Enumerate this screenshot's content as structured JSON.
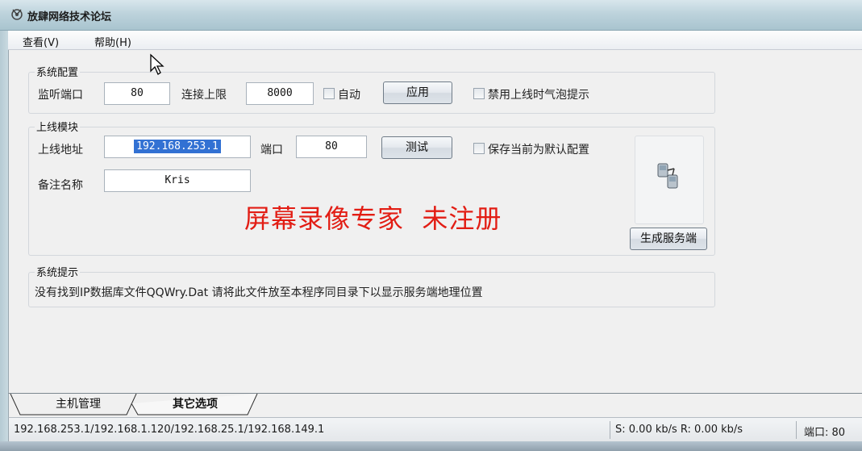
{
  "window": {
    "title": "放肆网络技术论坛",
    "icon": "app-icon"
  },
  "menu": {
    "items": [
      {
        "label": "查看(V)"
      },
      {
        "label": "帮助(H)"
      }
    ]
  },
  "system_config": {
    "title": "系统配置",
    "listen_port_label": "监听端口",
    "listen_port_value": "80",
    "connect_limit_label": "连接上限",
    "connect_limit_value": "8000",
    "auto_label": "自动",
    "auto_checked": false,
    "apply_button": "应用",
    "disable_bubble_label": "禁用上线时气泡提示",
    "disable_bubble_checked": false
  },
  "online_module": {
    "title": "上线模块",
    "address_label": "上线地址",
    "address_value": "192.168.253.1",
    "port_label": "端口",
    "port_value": "80",
    "test_button": "测试",
    "save_default_label": "保存当前为默认配置",
    "save_default_checked": false,
    "remark_label": "备注名称",
    "remark_value": "Kris",
    "generate_button": "生成服务端",
    "server_icon": "computers-network-icon"
  },
  "watermark": {
    "text": "屏幕录像专家  未注册",
    "color": "#e21d14"
  },
  "system_hint": {
    "title": "系统提示",
    "message": "没有找到IP数据库文件QQWry.Dat 请将此文件放至本程序同目录下以显示服务端地理位置"
  },
  "tabs": [
    {
      "label": "主机管理",
      "active": false
    },
    {
      "label": "其它选项",
      "active": true
    }
  ],
  "status_bar": {
    "ips": "192.168.253.1/192.168.1.120/192.168.25.1/192.168.149.1",
    "speed": "S: 0.00 kb/s R: 0.00 kb/s",
    "port": "端口: 80"
  },
  "colors": {
    "selection": "#3271d3",
    "titlebar": "#bdd3dc"
  }
}
